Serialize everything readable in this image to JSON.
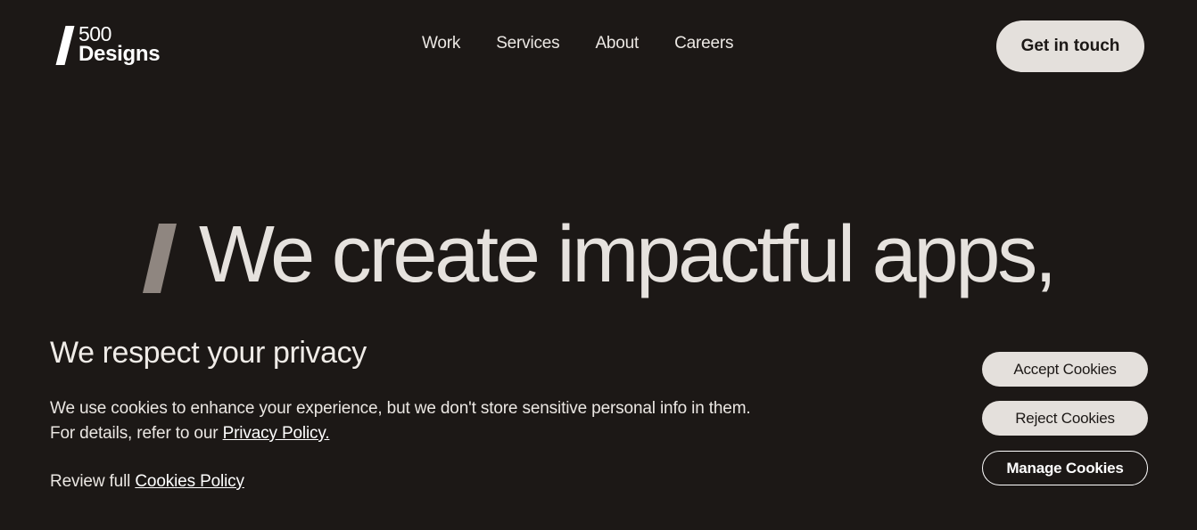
{
  "header": {
    "logo": {
      "number": "500",
      "word": "Designs"
    },
    "nav": [
      {
        "label": "Work"
      },
      {
        "label": "Services"
      },
      {
        "label": "About"
      },
      {
        "label": "Careers"
      }
    ],
    "cta_label": "Get in touch"
  },
  "hero": {
    "headline": "We create impactful apps,"
  },
  "cookie_banner": {
    "title": "We respect your privacy",
    "text_line1": "We use cookies to enhance your experience, but we don't store sensitive personal info in them.",
    "text_line2_prefix": "For details, refer to our ",
    "privacy_link": "Privacy Policy.",
    "review_prefix": "Review full ",
    "cookies_policy_link": "Cookies Policy",
    "accept_label": "Accept Cookies",
    "reject_label": "Reject Cookies",
    "manage_label": "Manage Cookies"
  },
  "colors": {
    "background": "#1c1816",
    "text": "#e6e2de",
    "button_fill": "#e4e0dc",
    "hero_slash": "#8f8680"
  }
}
